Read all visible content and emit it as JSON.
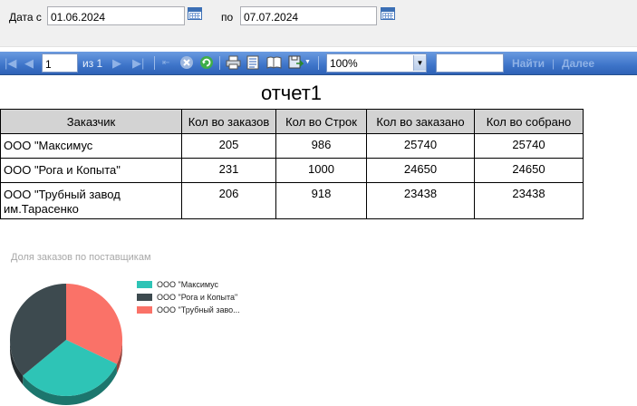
{
  "params": {
    "date_from_label": "Дата с",
    "date_from_value": "01.06.2024",
    "date_to_label": "по",
    "date_to_value": "07.07.2024"
  },
  "toolbar": {
    "page_value": "1",
    "page_of_label": "из 1",
    "zoom_value": "100%",
    "find_value": "",
    "find_label": "Найти",
    "next_label": "Далее"
  },
  "report": {
    "title": "отчет1",
    "columns": [
      "Заказчик",
      "Кол во заказов",
      "Кол во Строк",
      "Кол во заказано",
      "Кол во собрано"
    ],
    "rows": [
      {
        "customer": "ООО \"Максимус",
        "orders": "205",
        "lines": "986",
        "ordered": "25740",
        "collected": "25740"
      },
      {
        "customer": "ООО \"Рога и Копыта\"",
        "orders": "231",
        "lines": "1000",
        "ordered": "24650",
        "collected": "24650"
      },
      {
        "customer": "ООО \"Трубный завод им.Тарасенко",
        "orders": "206",
        "lines": "918",
        "ordered": "23438",
        "collected": "23438"
      }
    ]
  },
  "chart_data": {
    "type": "pie",
    "title": "Доля заказов по поставщикам",
    "legend_position": "right",
    "categories": [
      "ООО \"Максимус",
      "ООО \"Рога и Копыта\"",
      "ООО \"Трубный заво..."
    ],
    "values": [
      205,
      231,
      206
    ],
    "colors": [
      "#2ec4b6",
      "#3d4a4f",
      "#fa7268"
    ]
  }
}
